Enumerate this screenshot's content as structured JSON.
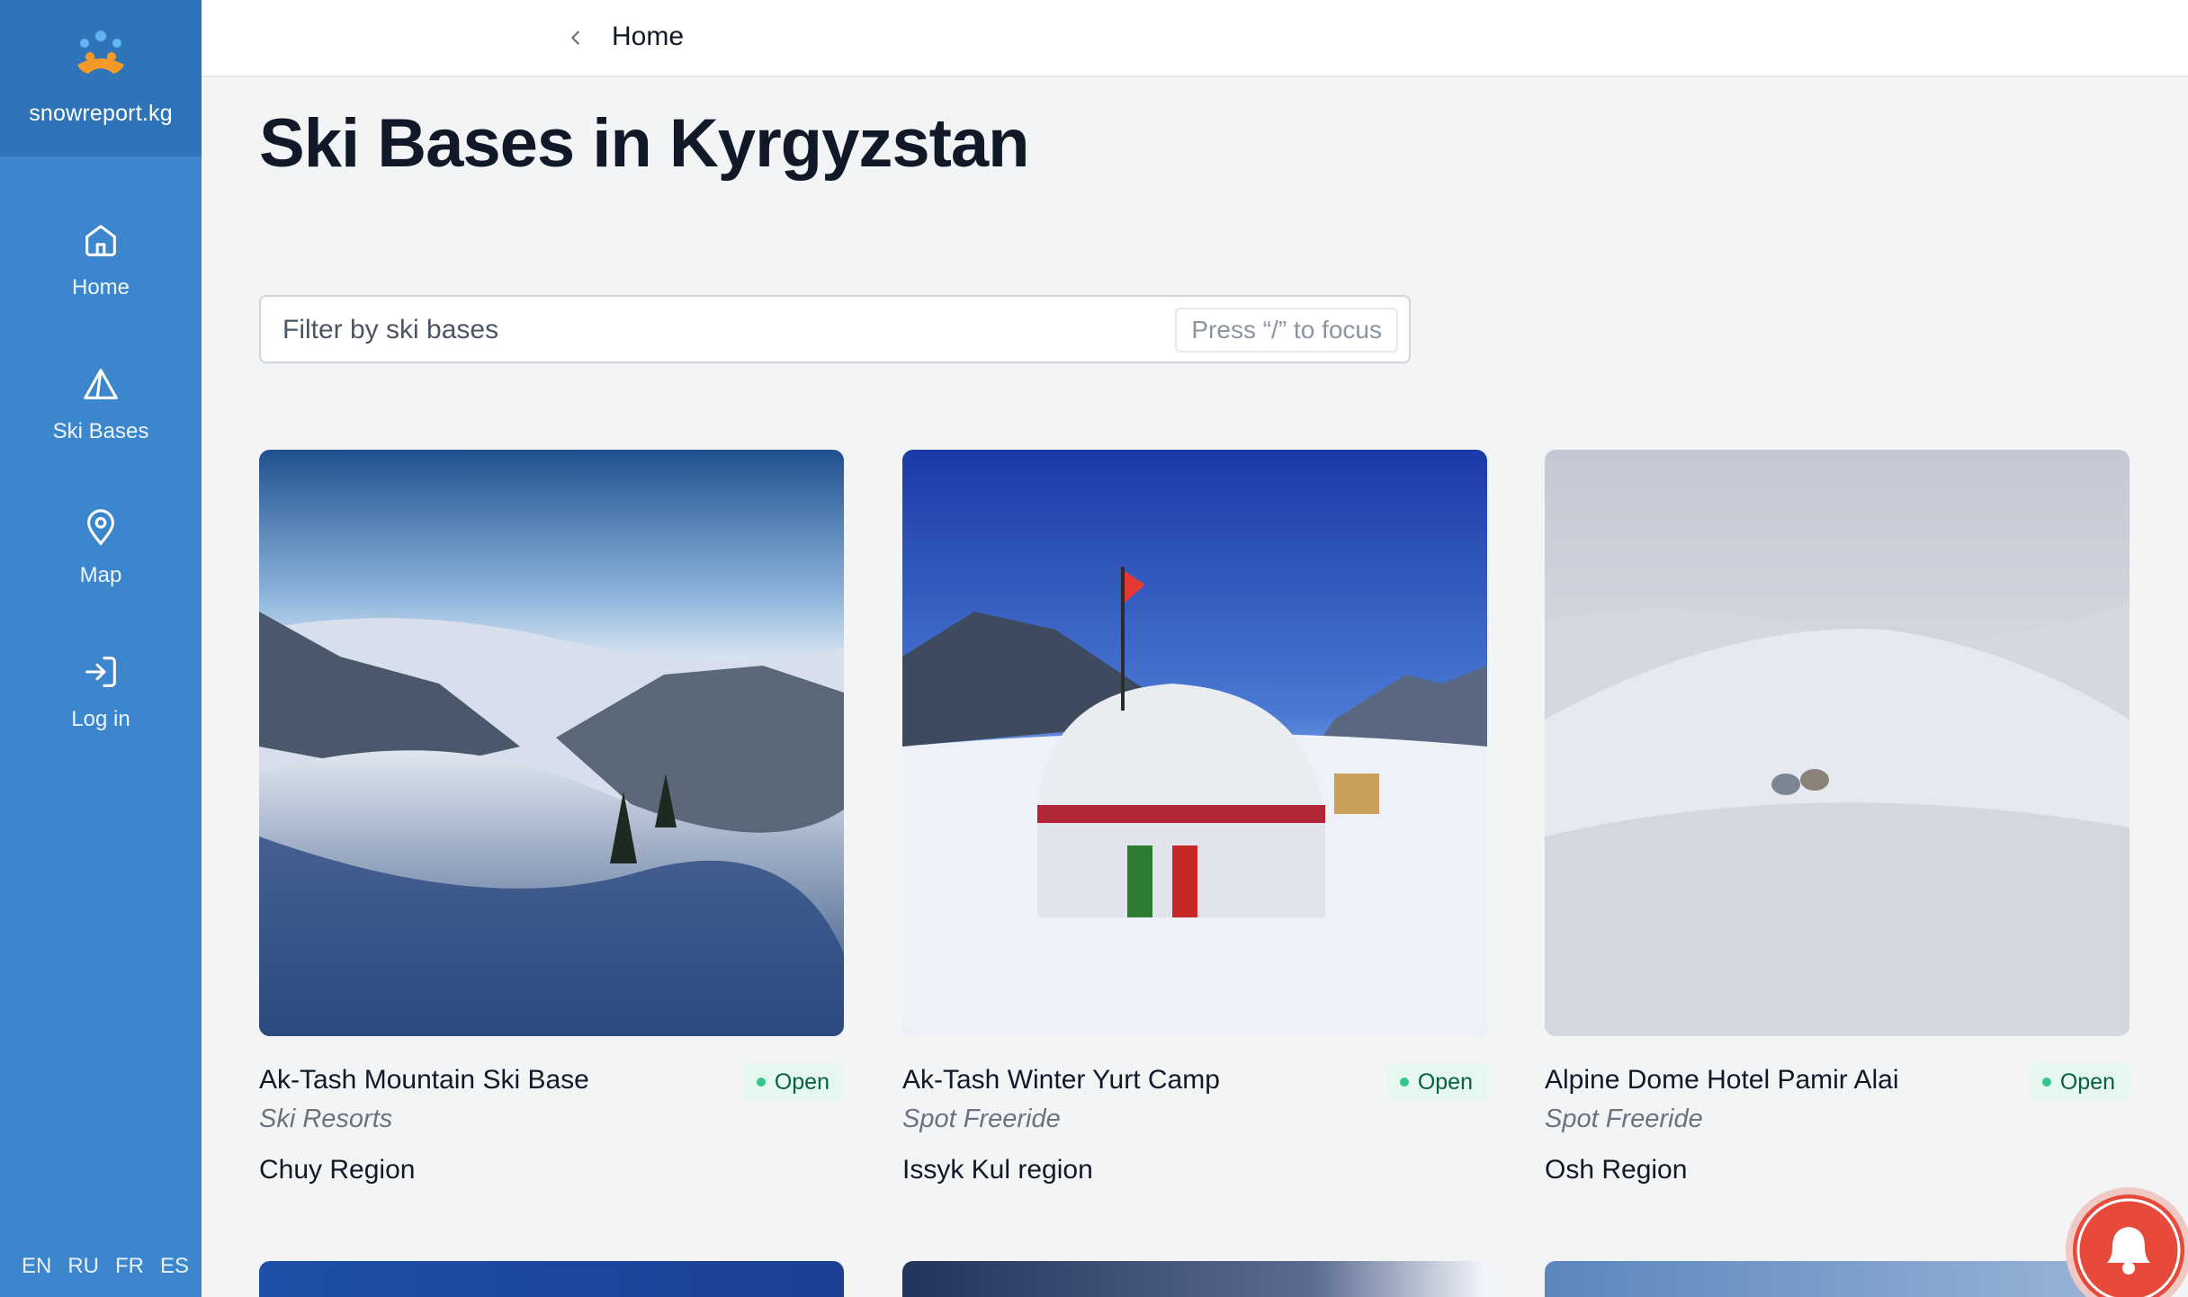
{
  "brand": {
    "name": "snowreport.kg"
  },
  "sidebar": {
    "items": [
      {
        "label": "Home",
        "icon": "home-icon"
      },
      {
        "label": "Ski Bases",
        "icon": "mountain-icon"
      },
      {
        "label": "Map",
        "icon": "map-pin-icon"
      },
      {
        "label": "Log in",
        "icon": "login-icon"
      }
    ],
    "languages": [
      "EN",
      "RU",
      "FR",
      "ES"
    ]
  },
  "header": {
    "breadcrumb": "Home"
  },
  "page": {
    "title": "Ski Bases in Kyrgyzstan"
  },
  "search": {
    "placeholder": "Filter by ski bases",
    "shortcut_hint": "Press “/” to focus"
  },
  "cards": [
    {
      "name": "Ak-Tash Mountain Ski Base",
      "status": "Open",
      "category": "Ski Resorts",
      "region": "Chuy Region"
    },
    {
      "name": "Ak-Tash Winter Yurt Camp",
      "status": "Open",
      "category": "Spot Freeride",
      "region": "Issyk Kul region"
    },
    {
      "name": "Alpine Dome Hotel Pamir Alai",
      "status": "Open",
      "category": "Spot Freeride",
      "region": "Osh Region"
    }
  ],
  "colors": {
    "sidebar": "#3b86cc",
    "brand_bar": "#2f74b8",
    "open_badge_bg": "#e5f7ef",
    "open_badge_dot": "#34c78b",
    "notify_button": "#e74a3b"
  }
}
